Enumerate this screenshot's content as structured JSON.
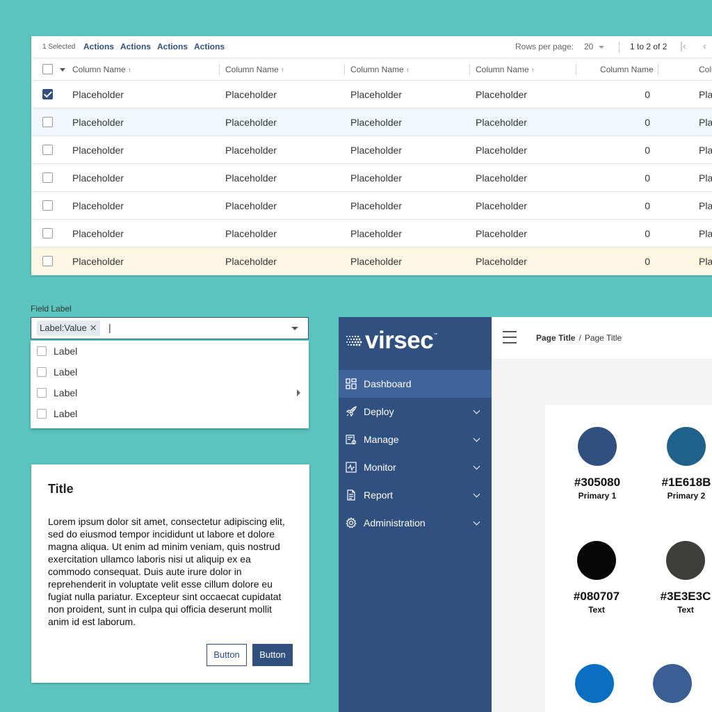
{
  "table": {
    "selected_text": "1 Selected",
    "actions": [
      "Actions",
      "Actions",
      "Actions",
      "Actions"
    ],
    "rows_per_page_label": "Rows per page:",
    "rows_per_page_value": "20",
    "range_text": "1 to 2 of 2",
    "columns": [
      "Column Name",
      "Column Name",
      "Column Name",
      "Column Name",
      "Column Name",
      "Colu"
    ],
    "rows": [
      {
        "checked": true,
        "state": "normal",
        "cells": [
          "Placeholder",
          "Placeholder",
          "Placeholder",
          "Placeholder",
          "0",
          "Pla"
        ]
      },
      {
        "checked": false,
        "state": "highlighted",
        "cells": [
          "Placeholder",
          "Placeholder",
          "Placeholder",
          "Placeholder",
          "0",
          "Pla"
        ]
      },
      {
        "checked": false,
        "state": "normal",
        "cells": [
          "Placeholder",
          "Placeholder",
          "Placeholder",
          "Placeholder",
          "0",
          "Pla"
        ]
      },
      {
        "checked": false,
        "state": "normal",
        "cells": [
          "Placeholder",
          "Placeholder",
          "Placeholder",
          "Placeholder",
          "0",
          "Pla"
        ]
      },
      {
        "checked": false,
        "state": "normal",
        "cells": [
          "Placeholder",
          "Placeholder",
          "Placeholder",
          "Placeholder",
          "0",
          "Pla"
        ]
      },
      {
        "checked": false,
        "state": "normal",
        "cells": [
          "Placeholder",
          "Placeholder",
          "Placeholder",
          "Placeholder",
          "0",
          "Pla"
        ]
      },
      {
        "checked": false,
        "state": "warning",
        "cells": [
          "Placeholder",
          "Placeholder",
          "Placeholder",
          "Placeholder",
          "0",
          "Pla"
        ]
      }
    ]
  },
  "multiselect": {
    "field_label": "Field Label",
    "chip": "Label:Value",
    "input_value": "|",
    "options": [
      {
        "label": "Label",
        "has_submenu": false
      },
      {
        "label": "Label",
        "has_submenu": false
      },
      {
        "label": "Label",
        "has_submenu": true
      },
      {
        "label": "Label",
        "has_submenu": false
      }
    ]
  },
  "dialog": {
    "title": "Title",
    "body": "Lorem ipsum dolor sit amet, consectetur adipiscing elit, sed do eiusmod tempor incididunt ut labore et dolore magna aliqua. Ut enim ad minim veniam, quis nostrud exercitation ullamco laboris nisi ut aliquip ex ea commodo consequat. Duis aute irure dolor in reprehenderit in voluptate velit esse cillum dolore eu fugiat nulla pariatur. Excepteur sint occaecat cupidatat non proident, sunt in culpa qui officia deserunt mollit anim id est laborum.",
    "secondary_button": "Button",
    "primary_button": "Button"
  },
  "app": {
    "logo_text": "virsec",
    "logo_tm": "™",
    "nav": [
      {
        "label": "Dashboard",
        "icon": "dashboard-icon",
        "active": true,
        "expandable": false
      },
      {
        "label": "Deploy",
        "icon": "rocket-icon",
        "active": false,
        "expandable": true
      },
      {
        "label": "Manage",
        "icon": "manage-icon",
        "active": false,
        "expandable": true
      },
      {
        "label": "Monitor",
        "icon": "monitor-icon",
        "active": false,
        "expandable": true
      },
      {
        "label": "Report",
        "icon": "document-icon",
        "active": false,
        "expandable": true
      },
      {
        "label": "Administration",
        "icon": "gear-icon",
        "active": false,
        "expandable": true
      }
    ],
    "breadcrumb": {
      "current": "Page Title",
      "sep": "/",
      "sub": "Page Title"
    },
    "swatches": [
      {
        "hex": "#305080",
        "name": "Primary 1",
        "color": "#305080"
      },
      {
        "hex": "#1E618B",
        "name": "Primary 2",
        "color": "#1e618b"
      },
      {
        "hex": "#080707",
        "name": "Text",
        "color": "#080707"
      },
      {
        "hex": "#3E3E3C",
        "name": "Text",
        "color": "#3e3e3c"
      },
      {
        "hex": "",
        "name": "",
        "color": "#0a6fc2"
      },
      {
        "hex": "",
        "name": "",
        "color": "#3a5f95"
      }
    ]
  },
  "colors": {
    "background": "#5bc4bf",
    "primary": "#305080",
    "row_highlight": "#f1f7fc",
    "row_warning": "#fdf6e3"
  }
}
